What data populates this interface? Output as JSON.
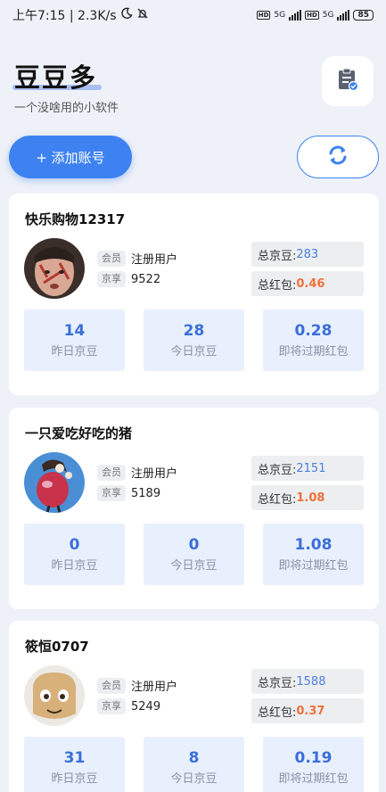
{
  "status_bar": {
    "time_speed": "上午7:15 | 2.3K/s",
    "network_hd1": "HD",
    "network_5g1": "5G",
    "network_hd2": "HD",
    "network_5g2": "5G",
    "battery": "85"
  },
  "header": {
    "title": "豆豆多",
    "subtitle": "一个没啥用的小软件",
    "add_account_label": "+ 添加账号"
  },
  "labels": {
    "member_tag": "会员",
    "jingxiang_tag": "京享",
    "total_beans": "总京豆:",
    "total_redpacket": "总红包:",
    "yesterday_beans": "昨日京豆",
    "today_beans": "今日京豆",
    "expiring_redpacket": "即将过期红包"
  },
  "accounts": [
    {
      "name": "快乐购物12317",
      "member_level": "注册用户",
      "jingxiang": "9522",
      "total_beans": "283",
      "total_redpacket": "0.46",
      "yesterday_beans": "14",
      "today_beans": "28",
      "expiring_redpacket": "0.28"
    },
    {
      "name": "一只爱吃好吃的猪",
      "member_level": "注册用户",
      "jingxiang": "5189",
      "total_beans": "2151",
      "total_redpacket": "1.08",
      "yesterday_beans": "0",
      "today_beans": "0",
      "expiring_redpacket": "1.08"
    },
    {
      "name": "筱恒0707",
      "member_level": "注册用户",
      "jingxiang": "5249",
      "total_beans": "1588",
      "total_redpacket": "0.37",
      "yesterday_beans": "31",
      "today_beans": "8",
      "expiring_redpacket": "0.19"
    }
  ],
  "colors": {
    "accent": "#3d82f0",
    "beans_value": "#4b7fe0",
    "redpacket_value": "#f0703a",
    "stat_bg": "#e8effd",
    "page_bg": "#eef1f8"
  }
}
